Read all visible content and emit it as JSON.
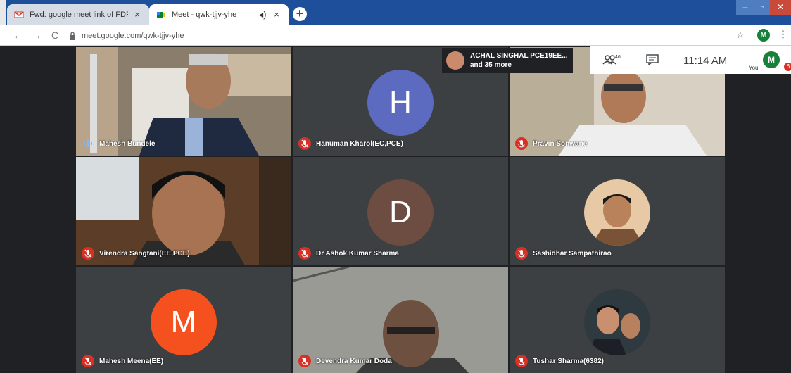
{
  "browser": {
    "tabs": [
      {
        "title": "Fwd: google meet link of FDP - ",
        "active": false
      },
      {
        "title": "Meet - qwk-tjjv-yhe",
        "active": true
      }
    ],
    "url": "meet.google.com/qwk-tjjv-yhe",
    "profile_initial": "M"
  },
  "meet": {
    "presenter_name": "ACHAL SINGHAL PCE19EE...",
    "presenter_more": "and 35 more",
    "people_count": "46",
    "time": "11:14 AM",
    "you_initial": "M",
    "you_label": "You",
    "you_badge": "6"
  },
  "participants": [
    {
      "name": "Mahesh Bundele",
      "speaking": true
    },
    {
      "name": "Hanuman Kharol(EC,PCE)",
      "letter": "H",
      "color": "#5c6bc0"
    },
    {
      "name": "Pravin Sonwane"
    },
    {
      "name": "Virendra Sangtani(EE,PCE)"
    },
    {
      "name": "Dr Ashok Kumar Sharma",
      "letter": "D",
      "color": "#6d4c41"
    },
    {
      "name": "Sashidhar Sampathirao"
    },
    {
      "name": "Mahesh Meena(EE)",
      "letter": "M",
      "color": "#f4511e"
    },
    {
      "name": "Devendra Kumar Doda"
    },
    {
      "name": "Tushar Sharma(6382)"
    }
  ]
}
